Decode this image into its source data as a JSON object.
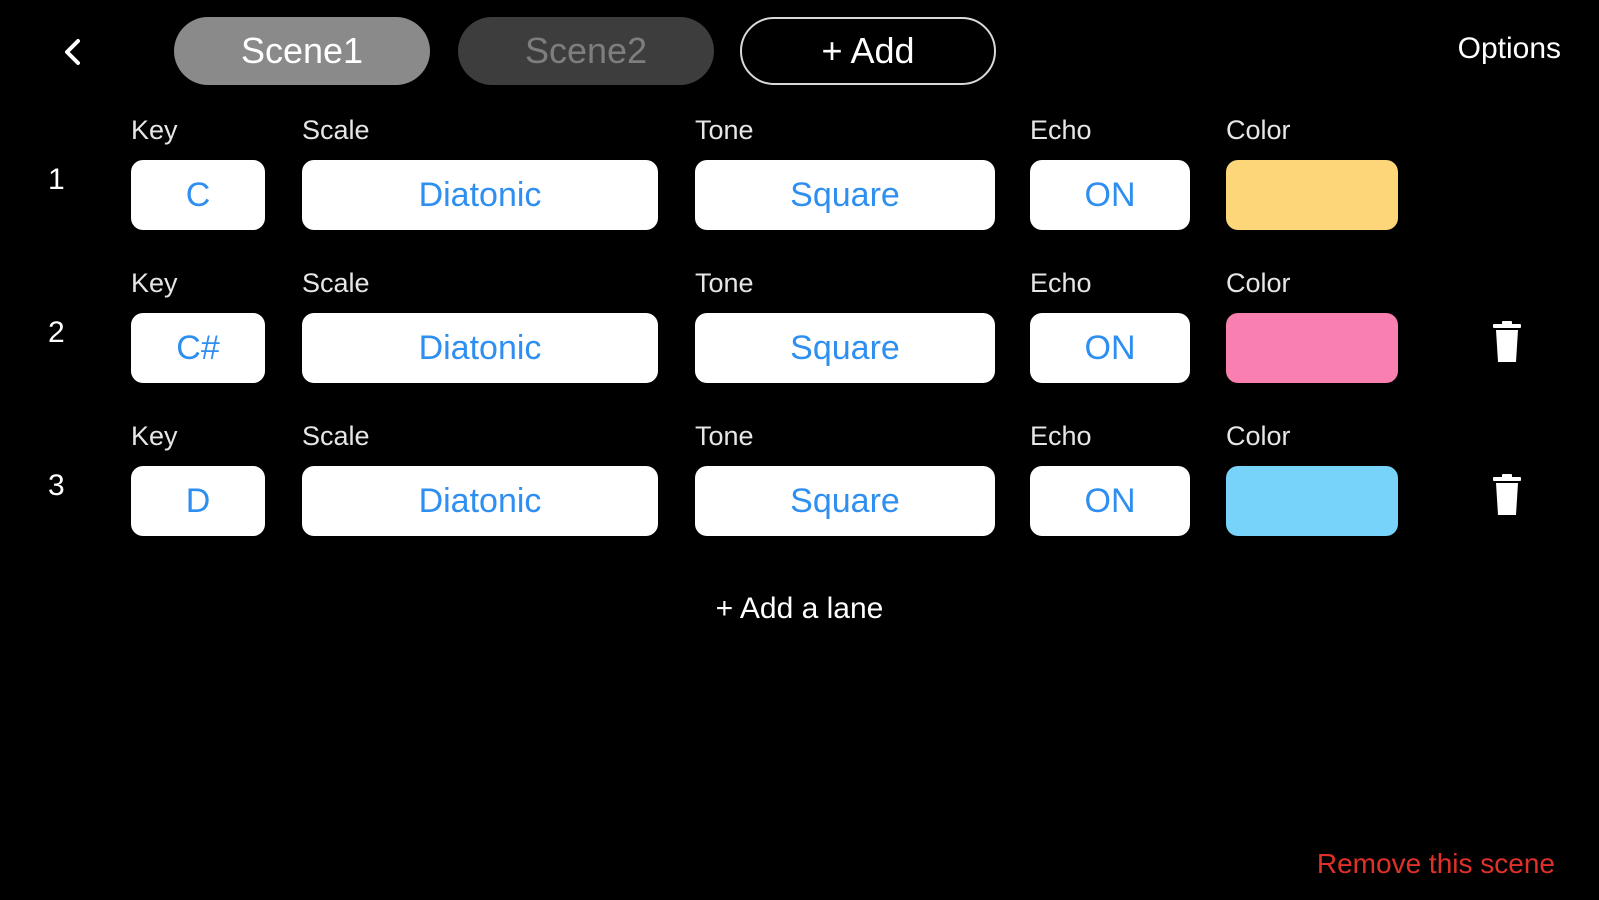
{
  "header": {
    "tabs": [
      {
        "label": "Scene1",
        "state": "active"
      },
      {
        "label": "Scene2",
        "state": "inactive"
      }
    ],
    "add_label": "+ Add",
    "options_label": "Options"
  },
  "lanes": [
    {
      "number": "1",
      "key_label": "Key",
      "key": "C",
      "scale_label": "Scale",
      "scale": "Diatonic",
      "tone_label": "Tone",
      "tone": "Square",
      "echo_label": "Echo",
      "echo": "ON",
      "color_label": "Color",
      "color": "#fdd67a",
      "deletable": false
    },
    {
      "number": "2",
      "key_label": "Key",
      "key": "C#",
      "scale_label": "Scale",
      "scale": "Diatonic",
      "tone_label": "Tone",
      "tone": "Square",
      "echo_label": "Echo",
      "echo": "ON",
      "color_label": "Color",
      "color": "#f97fb0",
      "deletable": true
    },
    {
      "number": "3",
      "key_label": "Key",
      "key": "D",
      "scale_label": "Scale",
      "scale": "Diatonic",
      "tone_label": "Tone",
      "tone": "Square",
      "echo_label": "Echo",
      "echo": "ON",
      "color_label": "Color",
      "color": "#78d3fa",
      "deletable": true
    }
  ],
  "add_lane_label": "+ Add a lane",
  "remove_scene_label": "Remove this scene",
  "colors": {
    "accent_text": "#2f8ff0",
    "danger": "#e0302a",
    "background": "#000000"
  },
  "icons": {
    "back": "chevron-left-icon",
    "delete": "trash-icon"
  }
}
